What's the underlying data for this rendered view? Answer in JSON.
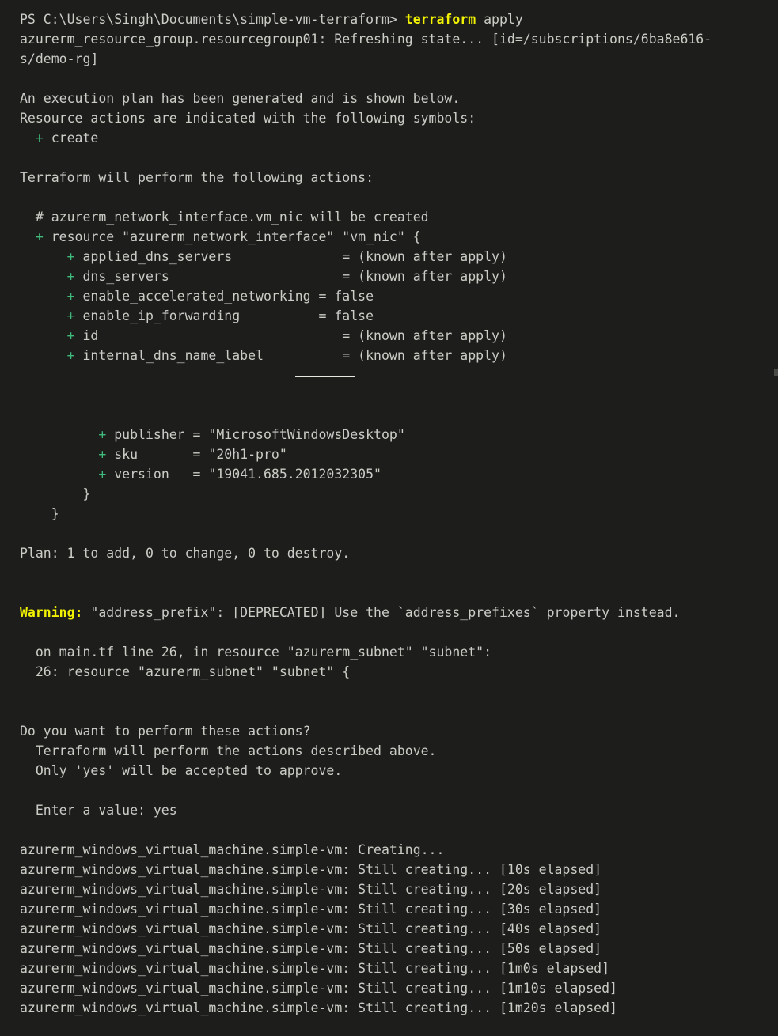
{
  "terminal": {
    "title": "Windows PowerShell — terraform apply",
    "background_color": "#1d1e1c",
    "foreground_color": "#ccccc6",
    "accent_yellow": "#f2f200",
    "accent_green": "#3fba7a",
    "prompt": "PS C:\\Users\\Singh\\Documents\\simple-vm-terraform>",
    "command": "terraform",
    "command_arg": " apply"
  },
  "lines": [
    {
      "id": "l1",
      "segments": [
        {
          "text": "PS C:\\Users\\Singh\\Documents\\simple-vm-terraform> ",
          "style": "plain"
        },
        {
          "text": "terraform",
          "style": "yellow"
        },
        {
          "text": " apply",
          "style": "plain"
        }
      ]
    },
    {
      "id": "l2",
      "text": "azurerm_resource_group.resourcegroup01: Refreshing state... [id=/subscriptions/6ba8e616-"
    },
    {
      "id": "l3",
      "text": "s/demo-rg]"
    },
    {
      "id": "l4",
      "text": ""
    },
    {
      "id": "l5",
      "text": "An execution plan has been generated and is shown below."
    },
    {
      "id": "l6",
      "text": "Resource actions are indicated with the following symbols:"
    },
    {
      "id": "l7",
      "segments": [
        {
          "text": "  ",
          "style": "plain"
        },
        {
          "text": "+",
          "style": "green"
        },
        {
          "text": " create",
          "style": "plain"
        }
      ]
    },
    {
      "id": "l8",
      "text": ""
    },
    {
      "id": "l9",
      "text": "Terraform will perform the following actions:"
    },
    {
      "id": "l10",
      "text": ""
    },
    {
      "id": "l11",
      "text": "  # azurerm_network_interface.vm_nic will be created"
    },
    {
      "id": "l12",
      "segments": [
        {
          "text": "  ",
          "style": "plain"
        },
        {
          "text": "+",
          "style": "green"
        },
        {
          "text": " resource \"azurerm_network_interface\" \"vm_nic\" {",
          "style": "plain"
        }
      ]
    },
    {
      "id": "l13",
      "segments": [
        {
          "text": "      ",
          "style": "plain"
        },
        {
          "text": "+",
          "style": "green"
        },
        {
          "text": " applied_dns_servers              = (known after apply)",
          "style": "plain"
        }
      ]
    },
    {
      "id": "l14",
      "segments": [
        {
          "text": "      ",
          "style": "plain"
        },
        {
          "text": "+",
          "style": "green"
        },
        {
          "text": " dns_servers                      = (known after apply)",
          "style": "plain"
        }
      ]
    },
    {
      "id": "l15",
      "segments": [
        {
          "text": "      ",
          "style": "plain"
        },
        {
          "text": "+",
          "style": "green"
        },
        {
          "text": " enable_accelerated_networking = false",
          "style": "plain"
        }
      ]
    },
    {
      "id": "l16",
      "segments": [
        {
          "text": "      ",
          "style": "plain"
        },
        {
          "text": "+",
          "style": "green"
        },
        {
          "text": " enable_ip_forwarding          = false",
          "style": "plain"
        }
      ]
    },
    {
      "id": "l17",
      "segments": [
        {
          "text": "      ",
          "style": "plain"
        },
        {
          "text": "+",
          "style": "green"
        },
        {
          "text": " id                               = (known after apply)",
          "style": "plain"
        }
      ]
    },
    {
      "id": "l18",
      "segments": [
        {
          "text": "      ",
          "style": "plain"
        },
        {
          "text": "+",
          "style": "green"
        },
        {
          "text": " internal_dns_name_label          = (known after apply)",
          "style": "plain"
        }
      ]
    },
    {
      "id": "l19",
      "text": ""
    },
    {
      "id": "l20",
      "text": ""
    },
    {
      "id": "l21",
      "text": ""
    },
    {
      "id": "l22",
      "segments": [
        {
          "text": "          ",
          "style": "plain"
        },
        {
          "text": "+",
          "style": "green"
        },
        {
          "text": " publisher = \"MicrosoftWindowsDesktop\"",
          "style": "plain"
        }
      ]
    },
    {
      "id": "l23",
      "segments": [
        {
          "text": "          ",
          "style": "plain"
        },
        {
          "text": "+",
          "style": "green"
        },
        {
          "text": " sku       = \"20h1-pro\"",
          "style": "plain"
        }
      ]
    },
    {
      "id": "l24",
      "segments": [
        {
          "text": "          ",
          "style": "plain"
        },
        {
          "text": "+",
          "style": "green"
        },
        {
          "text": " version   = \"19041.685.2012032305\"",
          "style": "plain"
        }
      ]
    },
    {
      "id": "l25",
      "text": "        }"
    },
    {
      "id": "l26",
      "text": "    }"
    },
    {
      "id": "l27",
      "text": ""
    },
    {
      "id": "l28",
      "text": "Plan: 1 to add, 0 to change, 0 to destroy."
    },
    {
      "id": "l29",
      "text": ""
    },
    {
      "id": "l30",
      "text": ""
    },
    {
      "id": "l31",
      "segments": [
        {
          "text": "Warning:",
          "style": "warn"
        },
        {
          "text": " \"address_prefix\": [DEPRECATED] Use the `address_prefixes` property instead.",
          "style": "plain"
        }
      ]
    },
    {
      "id": "l32",
      "text": ""
    },
    {
      "id": "l33",
      "text": "  on main.tf line 26, in resource \"azurerm_subnet\" \"subnet\":"
    },
    {
      "id": "l34",
      "text": "  26: resource \"azurerm_subnet\" \"subnet\" {"
    },
    {
      "id": "l35",
      "text": ""
    },
    {
      "id": "l36",
      "text": ""
    },
    {
      "id": "l37",
      "text": "Do you want to perform these actions?"
    },
    {
      "id": "l38",
      "text": "  Terraform will perform the actions described above."
    },
    {
      "id": "l39",
      "text": "  Only 'yes' will be accepted to approve."
    },
    {
      "id": "l40",
      "text": ""
    },
    {
      "id": "l41",
      "text": "  Enter a value: yes"
    },
    {
      "id": "l42",
      "text": ""
    },
    {
      "id": "l43",
      "text": "azurerm_windows_virtual_machine.simple-vm: Creating..."
    },
    {
      "id": "l44",
      "text": "azurerm_windows_virtual_machine.simple-vm: Still creating... [10s elapsed]"
    },
    {
      "id": "l45",
      "text": "azurerm_windows_virtual_machine.simple-vm: Still creating... [20s elapsed]"
    },
    {
      "id": "l46",
      "text": "azurerm_windows_virtual_machine.simple-vm: Still creating... [30s elapsed]"
    },
    {
      "id": "l47",
      "text": "azurerm_windows_virtual_machine.simple-vm: Still creating... [40s elapsed]"
    },
    {
      "id": "l48",
      "text": "azurerm_windows_virtual_machine.simple-vm: Still creating... [50s elapsed]"
    },
    {
      "id": "l49",
      "text": "azurerm_windows_virtual_machine.simple-vm: Still creating... [1m0s elapsed]"
    },
    {
      "id": "l50",
      "text": "azurerm_windows_virtual_machine.simple-vm: Still creating... [1m10s elapsed]"
    },
    {
      "id": "l51",
      "text": "azurerm_windows_virtual_machine.simple-vm: Still creating... [1m20s elapsed]"
    }
  ]
}
